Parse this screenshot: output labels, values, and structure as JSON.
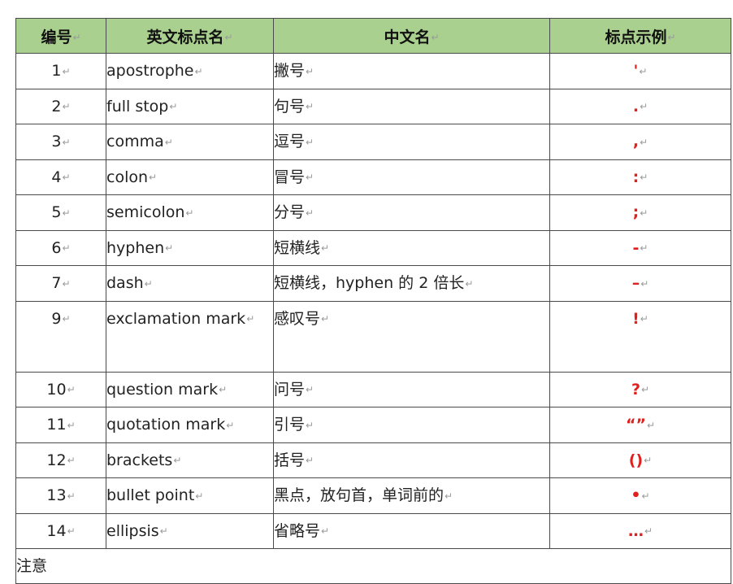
{
  "table": {
    "headers": [
      "编号",
      "英文标点名",
      "中文名",
      "标点示例"
    ],
    "para_mark": "↵",
    "rows": [
      {
        "num": "1",
        "en": "apostrophe",
        "zh": "撇号",
        "ex": "'"
      },
      {
        "num": "2",
        "en": "full stop",
        "zh": "句号",
        "ex": "."
      },
      {
        "num": "3",
        "en": "comma",
        "zh": "逗号",
        "ex": ","
      },
      {
        "num": "4",
        "en": "colon",
        "zh": "冒号",
        "ex": ":"
      },
      {
        "num": "5",
        "en": "semicolon",
        "zh": "分号",
        "ex": ";"
      },
      {
        "num": "6",
        "en": "hyphen",
        "zh": "短横线",
        "ex": "-"
      },
      {
        "num": "7",
        "en": "dash",
        "zh": "短横线，hyphen 的 2 倍长",
        "ex": "–"
      },
      {
        "num": "9",
        "en": "exclamation mark",
        "zh": "感叹号",
        "ex": "!"
      },
      {
        "num": "10",
        "en": "question mark",
        "zh": "问号",
        "ex": "?"
      },
      {
        "num": "11",
        "en": "quotation mark",
        "zh": "引号",
        "ex": "“”"
      },
      {
        "num": "12",
        "en": "brackets",
        "zh": "括号",
        "ex": "()"
      },
      {
        "num": "13",
        "en": "bullet point",
        "zh": "黑点，放句首，单词前的",
        "ex": "•"
      },
      {
        "num": "14",
        "en": "ellipsis",
        "zh": "省略号",
        "ex": "…"
      }
    ],
    "note_label": "注意"
  },
  "colors": {
    "header_bg": "#a9d08e",
    "example_red": "#e0201c",
    "border": "#4a4a4a"
  }
}
